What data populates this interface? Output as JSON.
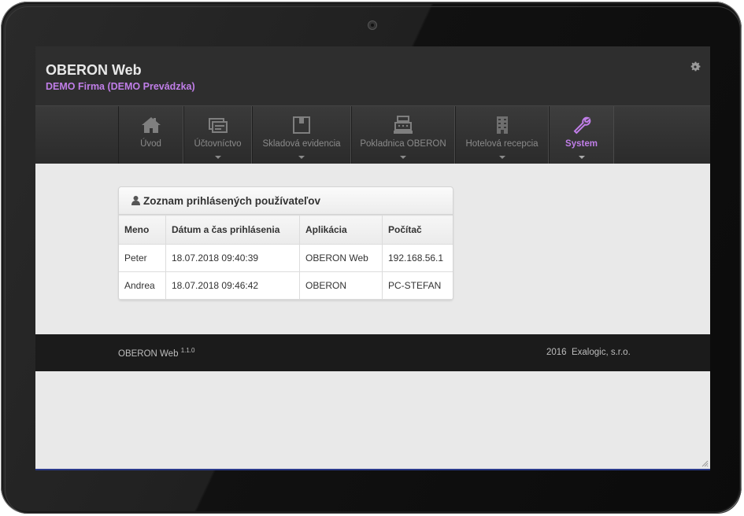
{
  "app": {
    "title": "OBERON Web",
    "subtitle": "DEMO Firma (DEMO Prevádzka)"
  },
  "nav": {
    "items": [
      {
        "label": "Úvod",
        "icon": "home-icon"
      },
      {
        "label": "Účtovníctvo",
        "icon": "accounting-icon"
      },
      {
        "label": "Skladová evidencia",
        "icon": "box-icon"
      },
      {
        "label": "Pokladnica OBERON",
        "icon": "cash-register-icon"
      },
      {
        "label": "Hotelová recepcia",
        "icon": "building-icon"
      },
      {
        "label": "System",
        "icon": "wrench-icon"
      }
    ],
    "active": "System"
  },
  "panel": {
    "title": "Zoznam prihlásených používateľov",
    "columns": [
      "Meno",
      "Dátum a čas prihlásenia",
      "Aplikácia",
      "Počítač"
    ],
    "rows": [
      [
        "Peter",
        "18.07.2018 09:40:39",
        "OBERON Web",
        "192.168.56.1"
      ],
      [
        "Andrea",
        "18.07.2018 09:46:42",
        "OBERON",
        "PC-STEFAN"
      ]
    ]
  },
  "footer": {
    "app_name": "OBERON Web",
    "version": "1.1.0",
    "year": "2016",
    "company": "Exalogic, s.r.o."
  },
  "colors": {
    "accent": "#c07ee8",
    "topbar": "#2e2e2e",
    "footer": "#1b1b1b",
    "content_bg": "#e9e9e9"
  }
}
